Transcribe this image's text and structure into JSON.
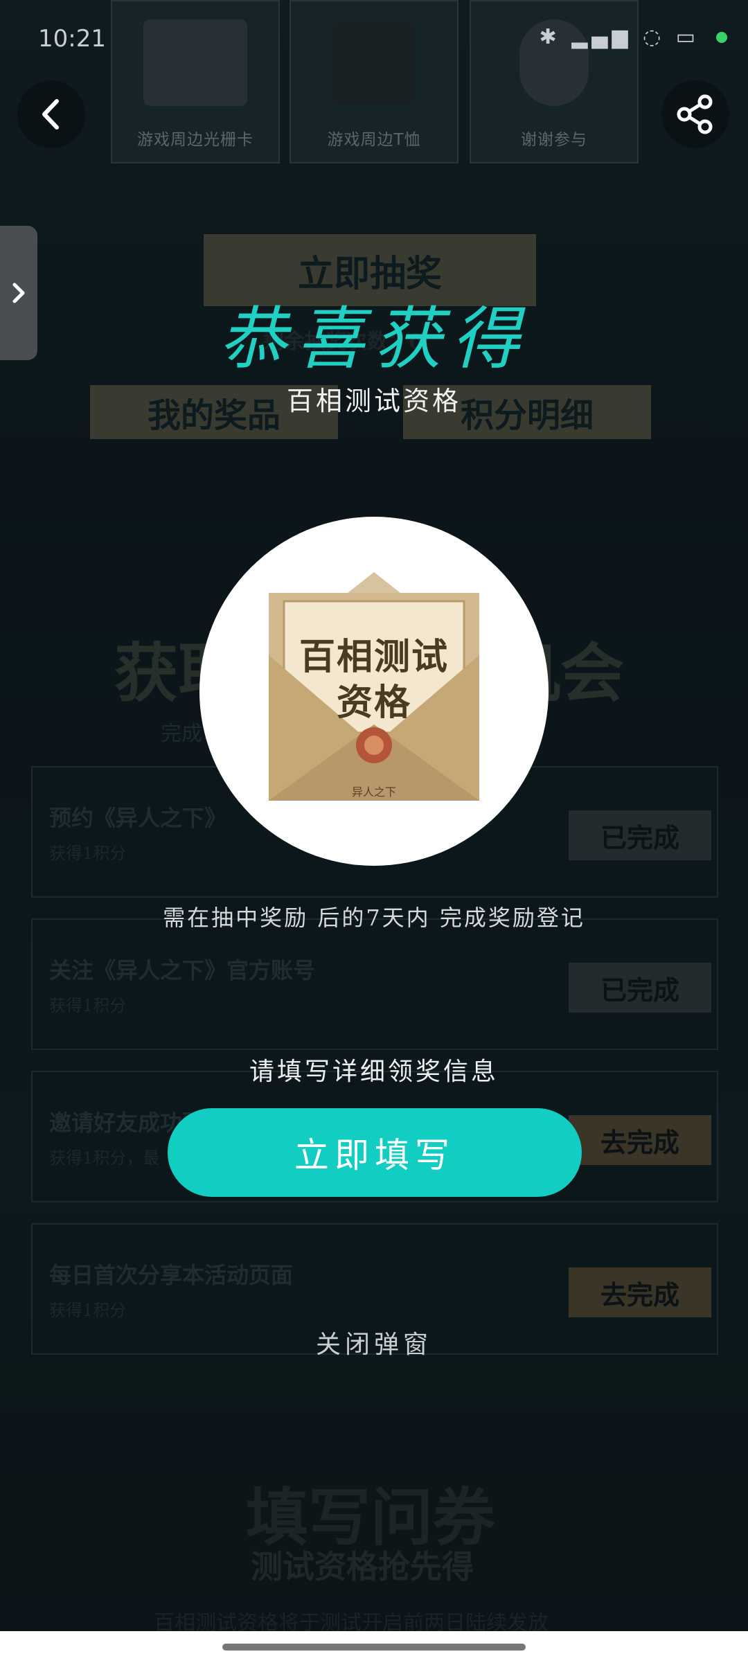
{
  "status_bar": {
    "time": "10:21",
    "icons": "✱ ▂▄▆ ◌ ▭"
  },
  "top_prizes": [
    {
      "label": "游戏周边光栅卡"
    },
    {
      "label": "游戏周边T恤"
    },
    {
      "label": "谢谢参与"
    }
  ],
  "background": {
    "draw_button": "立即抽奖",
    "remaining": "剩余抽奖次数：0",
    "my_prizes": "我的奖品",
    "points_detail": "积分明细",
    "section_title": "获取更多抽奖机会",
    "section_sub": "完成以下任务，获得积分",
    "tasks": [
      {
        "title": "预约《异人之下》",
        "sub": "获得1积分",
        "button": "已完成",
        "state": "done"
      },
      {
        "title": "关注《异人之下》官方账号",
        "sub": "获得1积分",
        "button": "已完成",
        "state": "done"
      },
      {
        "title": "邀请好友成功预约",
        "sub": "获得1积分，最",
        "button": "去完成",
        "state": "todo"
      },
      {
        "title": "每日首次分享本活动页面",
        "sub": "获得1积分",
        "button": "去完成",
        "state": "todo"
      }
    ],
    "survey_title": "填写问券",
    "survey_sub": "测试资格抢先得",
    "survey_note": "百相测试资格将于测试开启前两日陆续发放"
  },
  "popup": {
    "title": "恭喜获得",
    "prize_name": "百相测试资格",
    "card_line1": "百相测试",
    "card_line2": "资格",
    "card_brand": "异人之下",
    "notice": "需在抽中奖励 后的7天内 完成奖励登记",
    "fill_hint": "请填写详细领奖信息",
    "fill_button": "立即填写",
    "close_link": "关闭弹窗"
  },
  "colors": {
    "accent": "#12cec2",
    "title": "#1fd0c3"
  }
}
